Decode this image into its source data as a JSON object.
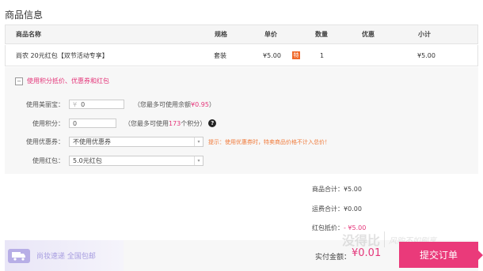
{
  "section_title": "商品信息",
  "table": {
    "headers": {
      "name": "商品名称",
      "spec": "规格",
      "price": "单价",
      "qty": "数量",
      "discount": "优惠",
      "subtotal": "小计"
    },
    "rows": [
      {
        "name": "尚农 20元红包【双节活动专享】",
        "spec": "套装",
        "price": "¥5.00",
        "promo_badge": "特",
        "qty": "1",
        "discount": "",
        "subtotal": "¥5.00"
      }
    ]
  },
  "discount_panel": {
    "toggle_symbol": "−",
    "toggle_label": "使用积分抵价、优惠券和红包",
    "balance": {
      "label": "使用美丽宝：",
      "currency_prefix": "¥",
      "value": "0",
      "hint_prefix": "（您最多可使用余额",
      "hint_amount": "¥0.95",
      "hint_suffix": "）"
    },
    "points": {
      "label": "使用积分：",
      "value": "0",
      "hint_prefix": "（您最多可使用",
      "hint_amount": "173",
      "hint_suffix": "个积分）",
      "help_icon": "?"
    },
    "coupon": {
      "label": "使用优惠券：",
      "selected": "不使用优惠券",
      "tip": "提示：使用优惠券时，特卖商品价格不计入总价！"
    },
    "redpacket": {
      "label": "使用红包：",
      "selected": "5.0元红包"
    }
  },
  "summary": {
    "goods_total_label": "商品合计：",
    "goods_total": "¥5.00",
    "shipping_label": "运费合计：",
    "shipping": "¥0.00",
    "redpacket_label": "红包抵价：",
    "redpacket": "- ¥5.00"
  },
  "bottom": {
    "shipping_promo": "尚妆速递 全国包邮",
    "pay_label": "实付金额：",
    "pay_amount": "¥0.01",
    "submit_label": "提交订单"
  },
  "watermark": {
    "main": "没得比",
    "sub": "风购不如刷享"
  },
  "colors": {
    "accent": "#e4367a",
    "submit": "#ea3a7a",
    "badge": "#f06a2b",
    "panel_bg": "#f7f7f7"
  }
}
